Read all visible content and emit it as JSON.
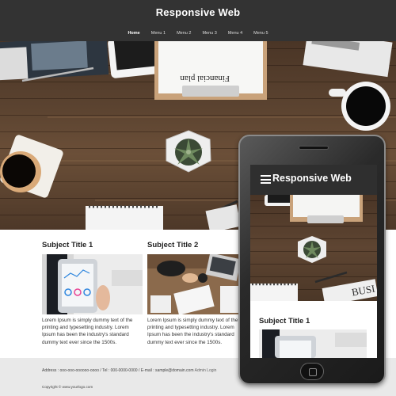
{
  "site": {
    "title": "Responsive Web"
  },
  "nav": {
    "items": [
      {
        "label": "Home",
        "active": true
      },
      {
        "label": "Menu 1"
      },
      {
        "label": "Menu 2"
      },
      {
        "label": "Menu 3"
      },
      {
        "label": "Menu 4"
      },
      {
        "label": "Menu 5"
      }
    ]
  },
  "hero": {
    "clipboard_text": "Financial plan"
  },
  "columns": [
    {
      "title": "Subject Title 1",
      "image": "tablet-analytics-photo",
      "text": "Lorem Ipsum is simply dummy text of the printing and typesetting industry. Lorem Ipsum has been the industry's standard dummy text ever since the 1500s."
    },
    {
      "title": "Subject Title 2",
      "image": "business-meeting-photo",
      "text": "Lorem Ipsum is simply dummy text of the printing and typesetting industry. Lorem Ipsum has been the industry's standard dummy text ever since the 1500s."
    }
  ],
  "footer": {
    "address": "Address : ooo-ooo-oooooo-oooo / Tel : 000-0000-0000 / E-mail : sample@domain.com",
    "admin_link": "Admin Login",
    "copyright": "Copyright © www.yourlogo.com"
  },
  "phone": {
    "title": "Responsive Web",
    "subject_title": "Subject Title 1",
    "busi_text": "BUSI"
  },
  "colors": {
    "header_bg": "#333333",
    "footer_bg": "#e9e9e9",
    "wood": "#5b4330"
  }
}
